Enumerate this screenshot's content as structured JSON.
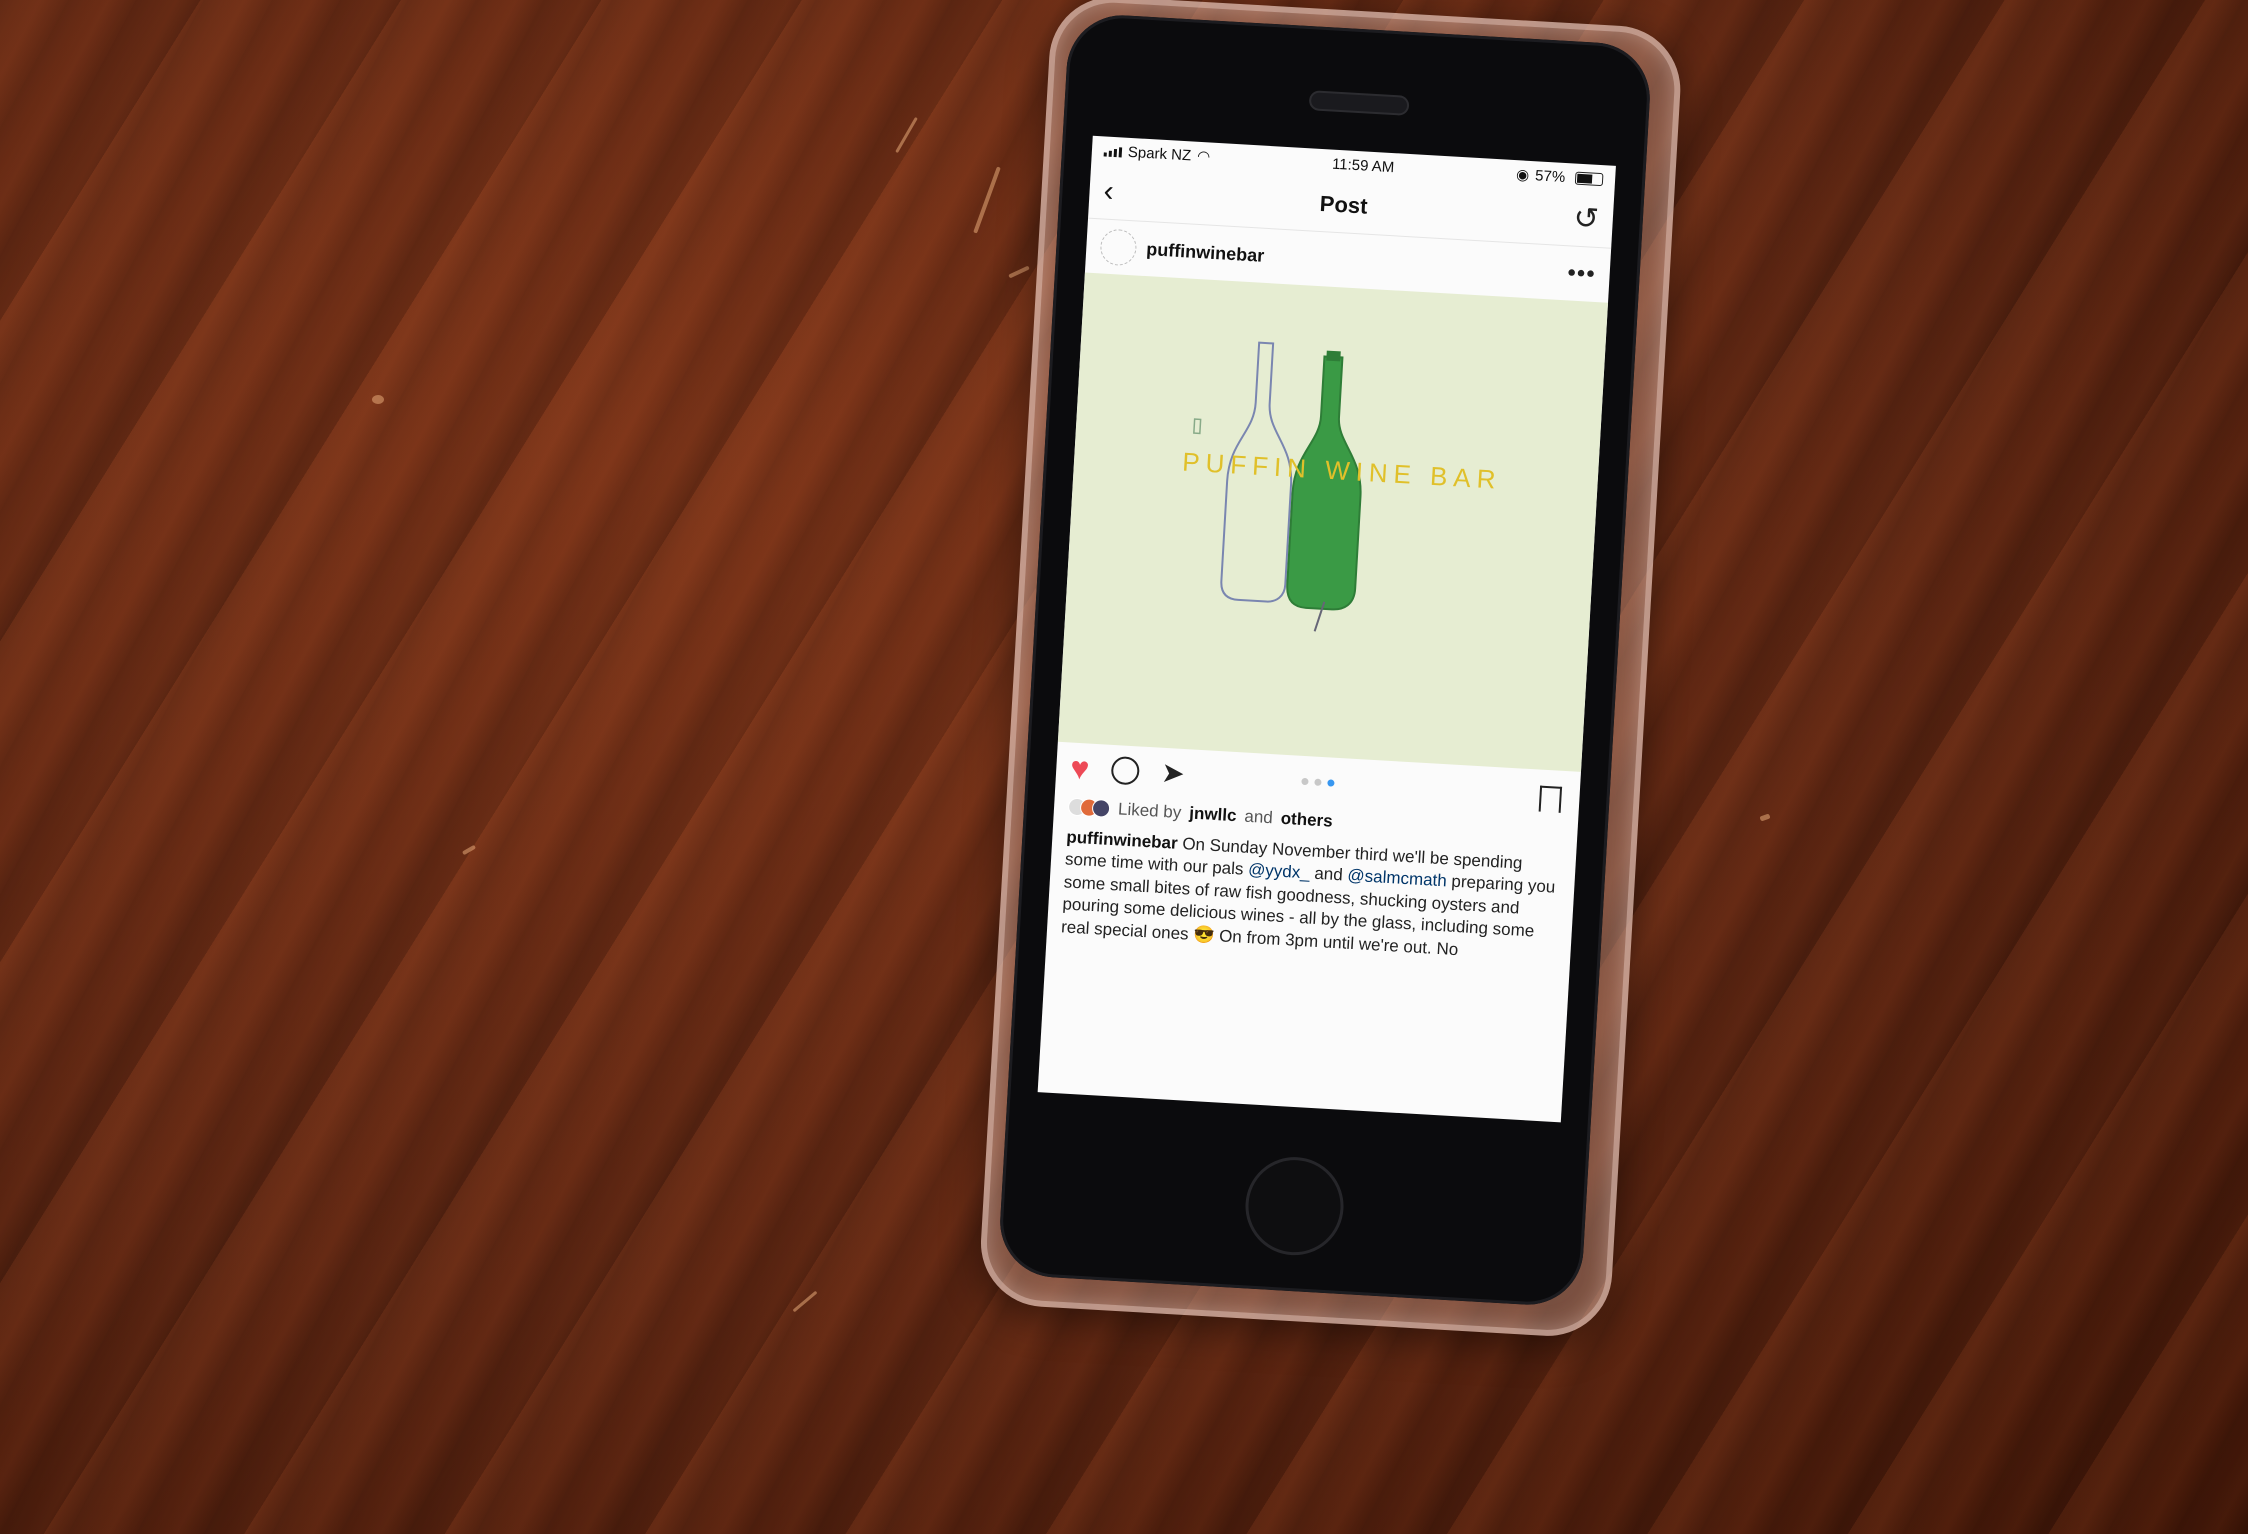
{
  "status_bar": {
    "carrier": "Spark NZ",
    "time": "11:59 AM",
    "battery": "57%"
  },
  "nav": {
    "title": "Post"
  },
  "post": {
    "username": "puffinwinebar",
    "image_text": "PUFFIN WINE BAR",
    "carousel_pages": 3,
    "carousel_active_index": 2,
    "liked_prefix": "Liked by",
    "liked_by": "jnwllc",
    "liked_and": "and",
    "liked_others": "others",
    "caption_user": "puffinwinebar",
    "caption_1": "On Sunday November third we'll be spending some time with our pals",
    "mention_1": "@yydx_",
    "caption_2": "and",
    "mention_2": "@salmcmath",
    "caption_3": "preparing you some small bites of raw fish goodness, shucking oysters and pouring some delicious wines - all by the glass, including some real special ones",
    "emoji": "😎",
    "caption_4": "On from 3pm until we're out. No"
  },
  "colors": {
    "heart": "#ed4956",
    "active_dot": "#3897f0",
    "image_bg": "#e6edd2",
    "bottle_green": "#3a9a45",
    "title_yellow": "#e0c02a"
  },
  "icons": [
    "signal-icon",
    "wifi-icon",
    "location-icon",
    "battery-icon",
    "back-icon",
    "refresh-icon",
    "more-icon",
    "heart-icon",
    "comment-icon",
    "share-icon",
    "bookmark-icon"
  ]
}
